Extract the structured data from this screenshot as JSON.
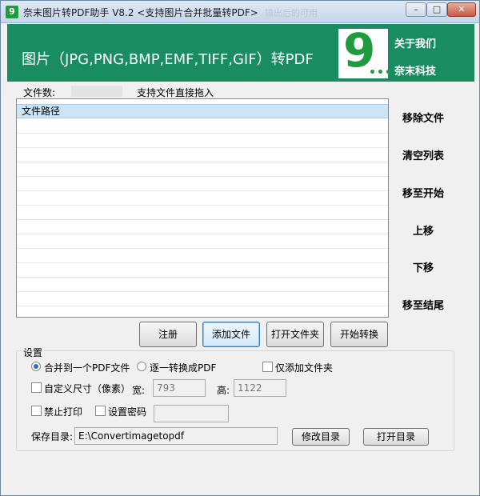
{
  "window": {
    "title": "奈末图片转PDF助手 V8.2 <支持图片合并批量转PDF>",
    "title_ghost": "输出后的可用",
    "minimize": "–",
    "maximize": "□",
    "close": "✕"
  },
  "banner": {
    "title": "图片（JPG,PNG,BMP,EMF,TIFF,GIF）转PDF",
    "logo": "9",
    "about_link": "关于我们",
    "company_link": "奈末科技",
    "color": "#1a8c62"
  },
  "file_info": {
    "count_label": "文件数:",
    "drag_hint": "支持文件直接拖入"
  },
  "file_list": {
    "header": "文件路径",
    "rows": []
  },
  "side_actions": {
    "remove": "移除文件",
    "clear": "清空列表",
    "move_top": "移至开始",
    "move_up": "上移",
    "move_down": "下移",
    "move_bottom": "移至结尾"
  },
  "actions": {
    "register": "注册",
    "add_files": "添加文件",
    "add_folder": "打开文件夹",
    "start": "开始转换"
  },
  "settings": {
    "legend": "设置",
    "merge_option": "合并到一个PDF文件",
    "each_option": "逐一转换成PDF",
    "folder_only": "仅添加文件夹",
    "custom_size": "自定义尺寸（像素）",
    "width_label": "宽:",
    "width_value": "793",
    "height_label": "高:",
    "height_value": "1122",
    "no_print": "禁止打印",
    "set_password": "设置密码",
    "password_value": "",
    "save_dir_label": "保存目录:",
    "save_dir_value": "E:\\Convertimagetopdf",
    "change_dir": "修改目录",
    "open_dir": "打开目录",
    "merge_selected": true
  }
}
